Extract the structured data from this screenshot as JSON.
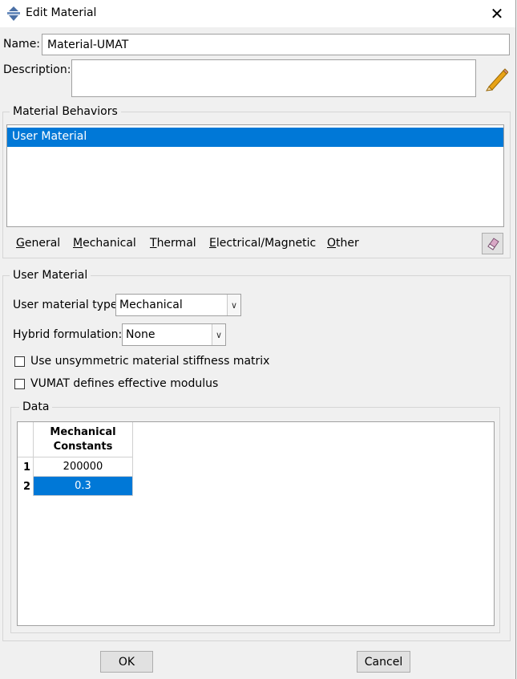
{
  "window": {
    "title": "Edit Material",
    "close_glyph": "✕"
  },
  "name": {
    "label": "Name:",
    "value": "Material-UMAT"
  },
  "description": {
    "label": "Description:",
    "value": ""
  },
  "material_behaviors": {
    "legend": "Material Behaviors",
    "items": [
      "User Material"
    ],
    "selected_index": 0,
    "menu": [
      {
        "label": "General",
        "mnemonic": "G"
      },
      {
        "label": "Mechanical",
        "mnemonic": "M"
      },
      {
        "label": "Thermal",
        "mnemonic": "T"
      },
      {
        "label": "Electrical/Magnetic",
        "mnemonic": "E"
      },
      {
        "label": "Other",
        "mnemonic": "O"
      }
    ]
  },
  "user_material": {
    "legend": "User Material",
    "type_label": "User material type:",
    "type_value": "Mechanical",
    "hybrid_label": "Hybrid formulation:",
    "hybrid_value": "None",
    "checkbox_unsymmetric": {
      "label": "Use unsymmetric material stiffness matrix",
      "checked": false
    },
    "checkbox_vumat": {
      "label": "VUMAT defines effective modulus",
      "checked": false
    }
  },
  "data": {
    "legend": "Data",
    "column_header_line1": "Mechanical",
    "column_header_line2": "Constants",
    "rows": [
      {
        "index": "1",
        "value": "200000",
        "selected": false
      },
      {
        "index": "2",
        "value": "0.3",
        "selected": true
      }
    ]
  },
  "buttons": {
    "ok": "OK",
    "cancel": "Cancel"
  },
  "colors": {
    "selection": "#0078d7",
    "dialog_bg": "#f0f0f0",
    "pencil": "#e8a317"
  },
  "icons": {
    "title": "material-diamond-icon",
    "edit": "pencil-icon",
    "clear": "eraser-icon",
    "dropdown": "chevron-down-icon"
  }
}
